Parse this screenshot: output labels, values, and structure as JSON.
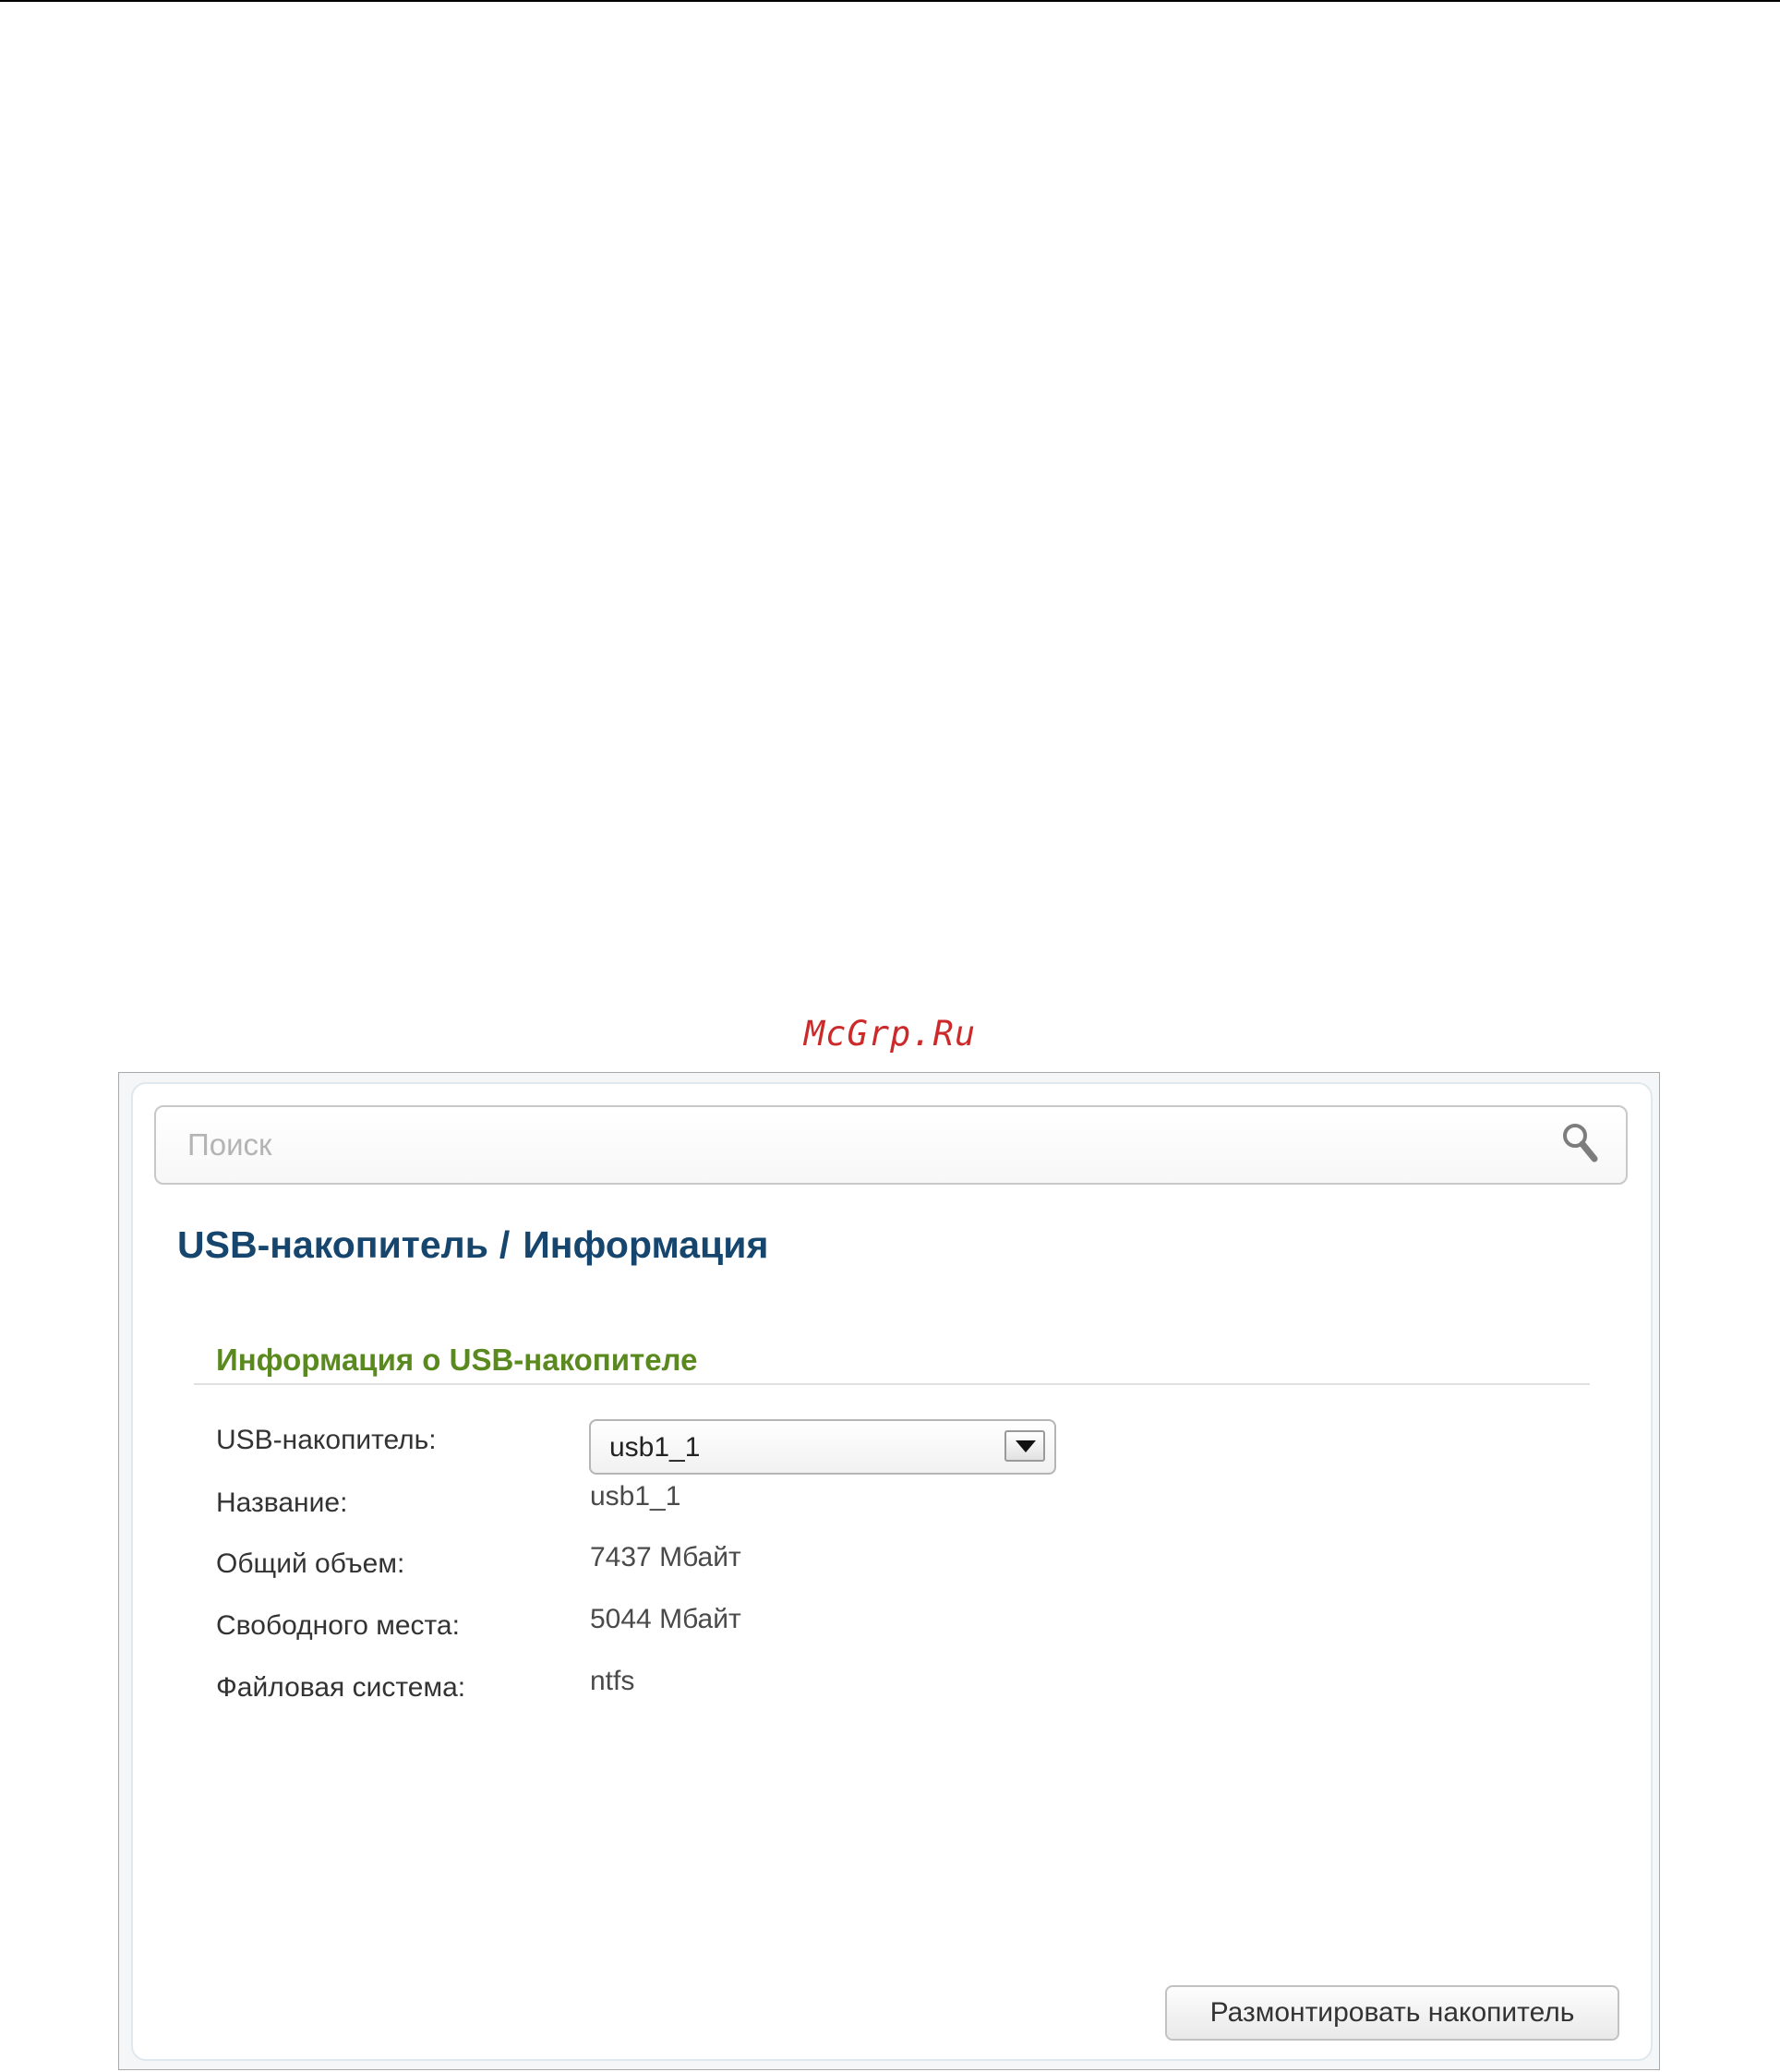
{
  "watermark": "McGrp.Ru",
  "search": {
    "placeholder": "Поиск",
    "icon": "magnifier"
  },
  "breadcrumb": {
    "section": "USB-накопитель",
    "separator": "/",
    "page": "Информация"
  },
  "info_section": {
    "title": "Информация о USB-накопителе",
    "fields": [
      {
        "label": "USB-накопитель:",
        "value": "usb1_1",
        "control": "select"
      },
      {
        "label": "Название:",
        "value": "usb1_1"
      },
      {
        "label": "Общий объем:",
        "value": "7437 Мбайт"
      },
      {
        "label": "Свободного места:",
        "value": "5044 Мбайт"
      },
      {
        "label": "Файловая система:",
        "value": "ntfs"
      }
    ]
  },
  "actions": {
    "unmount_label": "Размонтировать накопитель"
  },
  "colors": {
    "title": "#16466e",
    "section_title": "#5a8a1f",
    "watermark": "#cc2a2a"
  }
}
